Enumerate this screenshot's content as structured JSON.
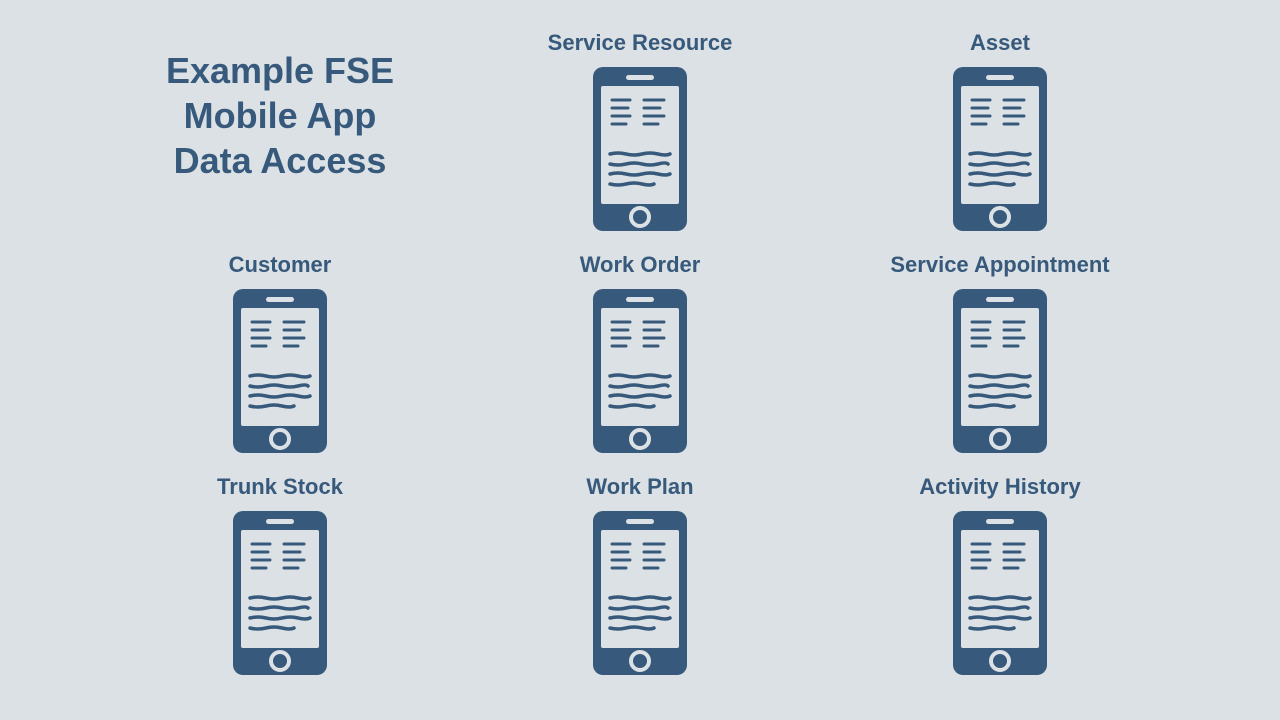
{
  "title": {
    "line1": "Example FSE",
    "line2": "Mobile App",
    "line3": "Data Access"
  },
  "colors": {
    "ink": "#37597b",
    "bg": "#dbe1e4"
  },
  "items": {
    "service_resource": "Service Resource",
    "asset": "Asset",
    "customer": "Customer",
    "work_order": "Work Order",
    "service_appointment": "Service Appointment",
    "trunk_stock": "Trunk Stock",
    "work_plan": "Work Plan",
    "activity_history": "Activity History"
  }
}
